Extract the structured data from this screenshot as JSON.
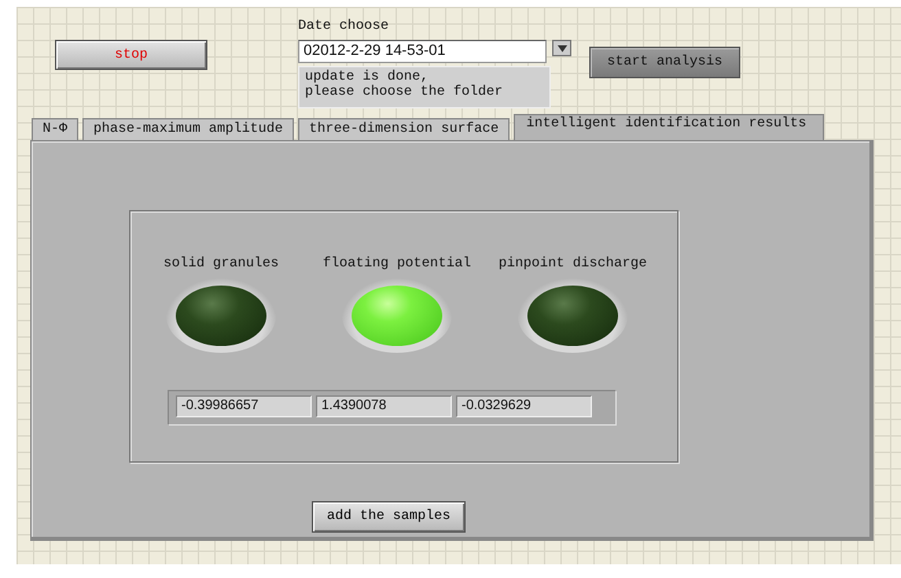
{
  "stop_button": {
    "label": "stop"
  },
  "date": {
    "label": "Date choose",
    "value": "02012-2-29 14-53-01"
  },
  "status_message": "update is done,\nplease choose the folder",
  "start_button": {
    "label": "start analysis"
  },
  "tabs": [
    {
      "label": "N-Φ",
      "selected": false
    },
    {
      "label": "phase-maximum amplitude",
      "selected": false
    },
    {
      "label": "three-dimension surface",
      "selected": false
    },
    {
      "label": "intelligent identification results",
      "selected": true
    }
  ],
  "indicators": [
    {
      "label": "solid granules",
      "on": false,
      "value": "-0.39986657"
    },
    {
      "label": "floating potential",
      "on": true,
      "value": "1.4390078"
    },
    {
      "label": "pinpoint discharge",
      "on": false,
      "value": "-0.0329629"
    }
  ],
  "add_button": {
    "label": "add the samples"
  }
}
